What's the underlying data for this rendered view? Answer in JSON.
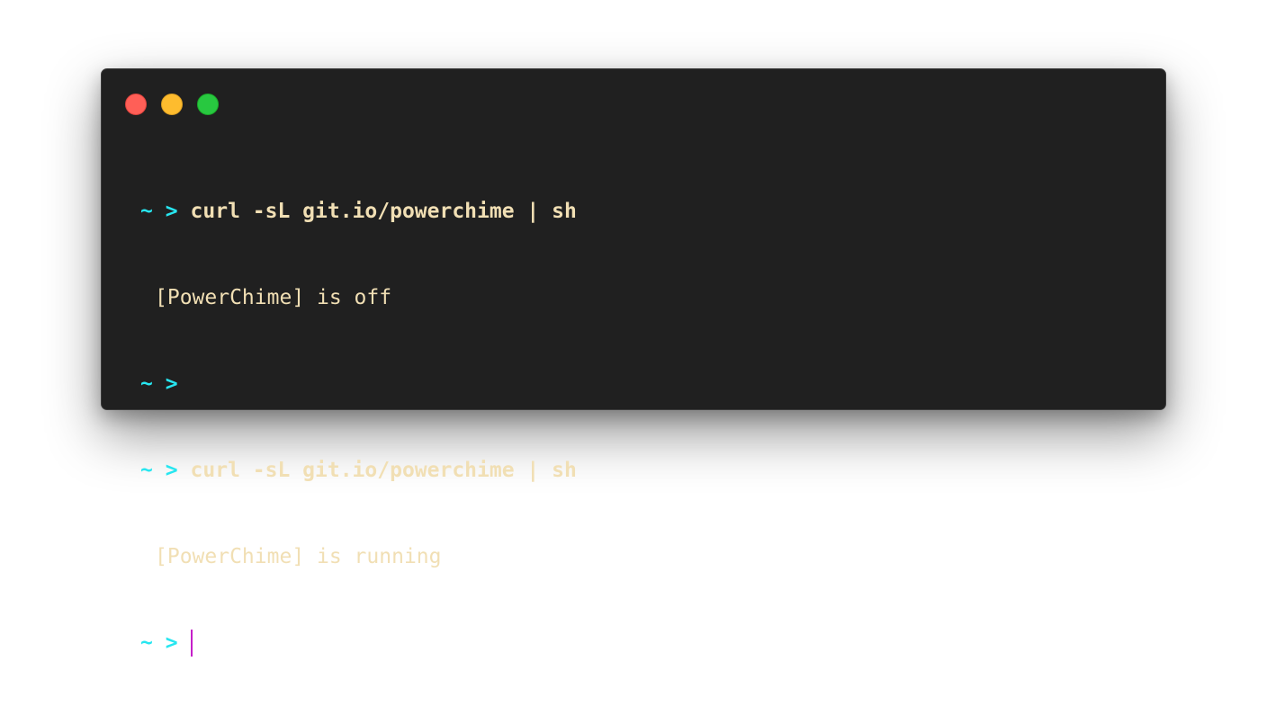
{
  "window": {
    "controls": {
      "close": "close",
      "minimize": "minimize",
      "zoom": "zoom"
    }
  },
  "colors": {
    "background": "#202020",
    "prompt": "#27e6f0",
    "text": "#f1dfb4",
    "cursor": "#c51fc9"
  },
  "terminal": {
    "lines": [
      {
        "type": "input",
        "prompt": "~ >",
        "command": "curl -sL git.io/powerchime | sh"
      },
      {
        "type": "output",
        "text": "[PowerChime] is off"
      },
      {
        "type": "input",
        "prompt": "~ >",
        "command": ""
      },
      {
        "type": "input",
        "prompt": "~ >",
        "command": "curl -sL git.io/powerchime | sh"
      },
      {
        "type": "output",
        "text": "[PowerChime] is running"
      },
      {
        "type": "input",
        "prompt": "~ >",
        "command": ""
      }
    ]
  }
}
